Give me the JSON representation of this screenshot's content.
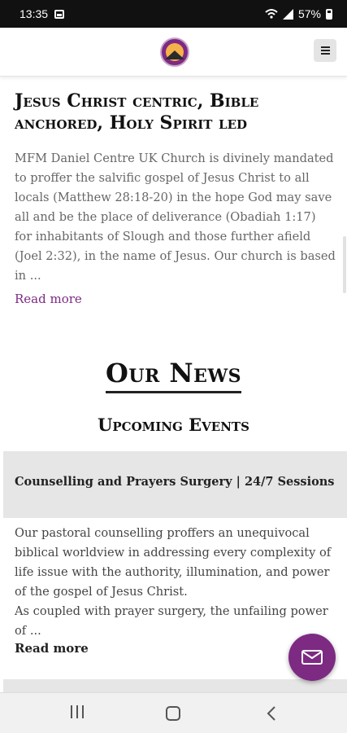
{
  "status_bar": {
    "time": "13:35",
    "battery": "57%"
  },
  "header": {
    "logo_name": "church-logo",
    "menu_icon": "hamburger-menu-icon"
  },
  "mission": {
    "title": "Jesus Christ centric, Bible anchored, Holy Spirit led",
    "text": "MFM Daniel Centre UK Church is divinely mandated to proffer the salvific gospel of Jesus Christ to all locals (Matthew 28:18-20) in the hope God may save all and be the place of deliverance (Obadiah 1:17) for inhabitants of Slough and those further afield (Joel 2:32), in the name of Jesus. Our church is based in ...",
    "read_more": "Read more"
  },
  "news": {
    "title": "Our News",
    "subtitle": "Upcoming Events",
    "events": [
      {
        "title": "Counselling and Prayers Surgery | 24/7 Sessions",
        "text": "Our pastoral counselling proffers an unequivocal biblical worldview in addressing every complexity of life issue with the authority, illumination, and power of the gospel of Jesus Christ.\nAs coupled with prayer surgery, the unfailing power of ...",
        "read_more": "Read more"
      }
    ]
  },
  "fab": {
    "icon": "mail-icon"
  },
  "nav": {
    "icons": [
      "recent-apps-icon",
      "home-icon",
      "back-icon"
    ]
  },
  "colors": {
    "accent": "#7d2a83",
    "status_bar": "#111111",
    "event_bar": "#e6e6e6"
  }
}
